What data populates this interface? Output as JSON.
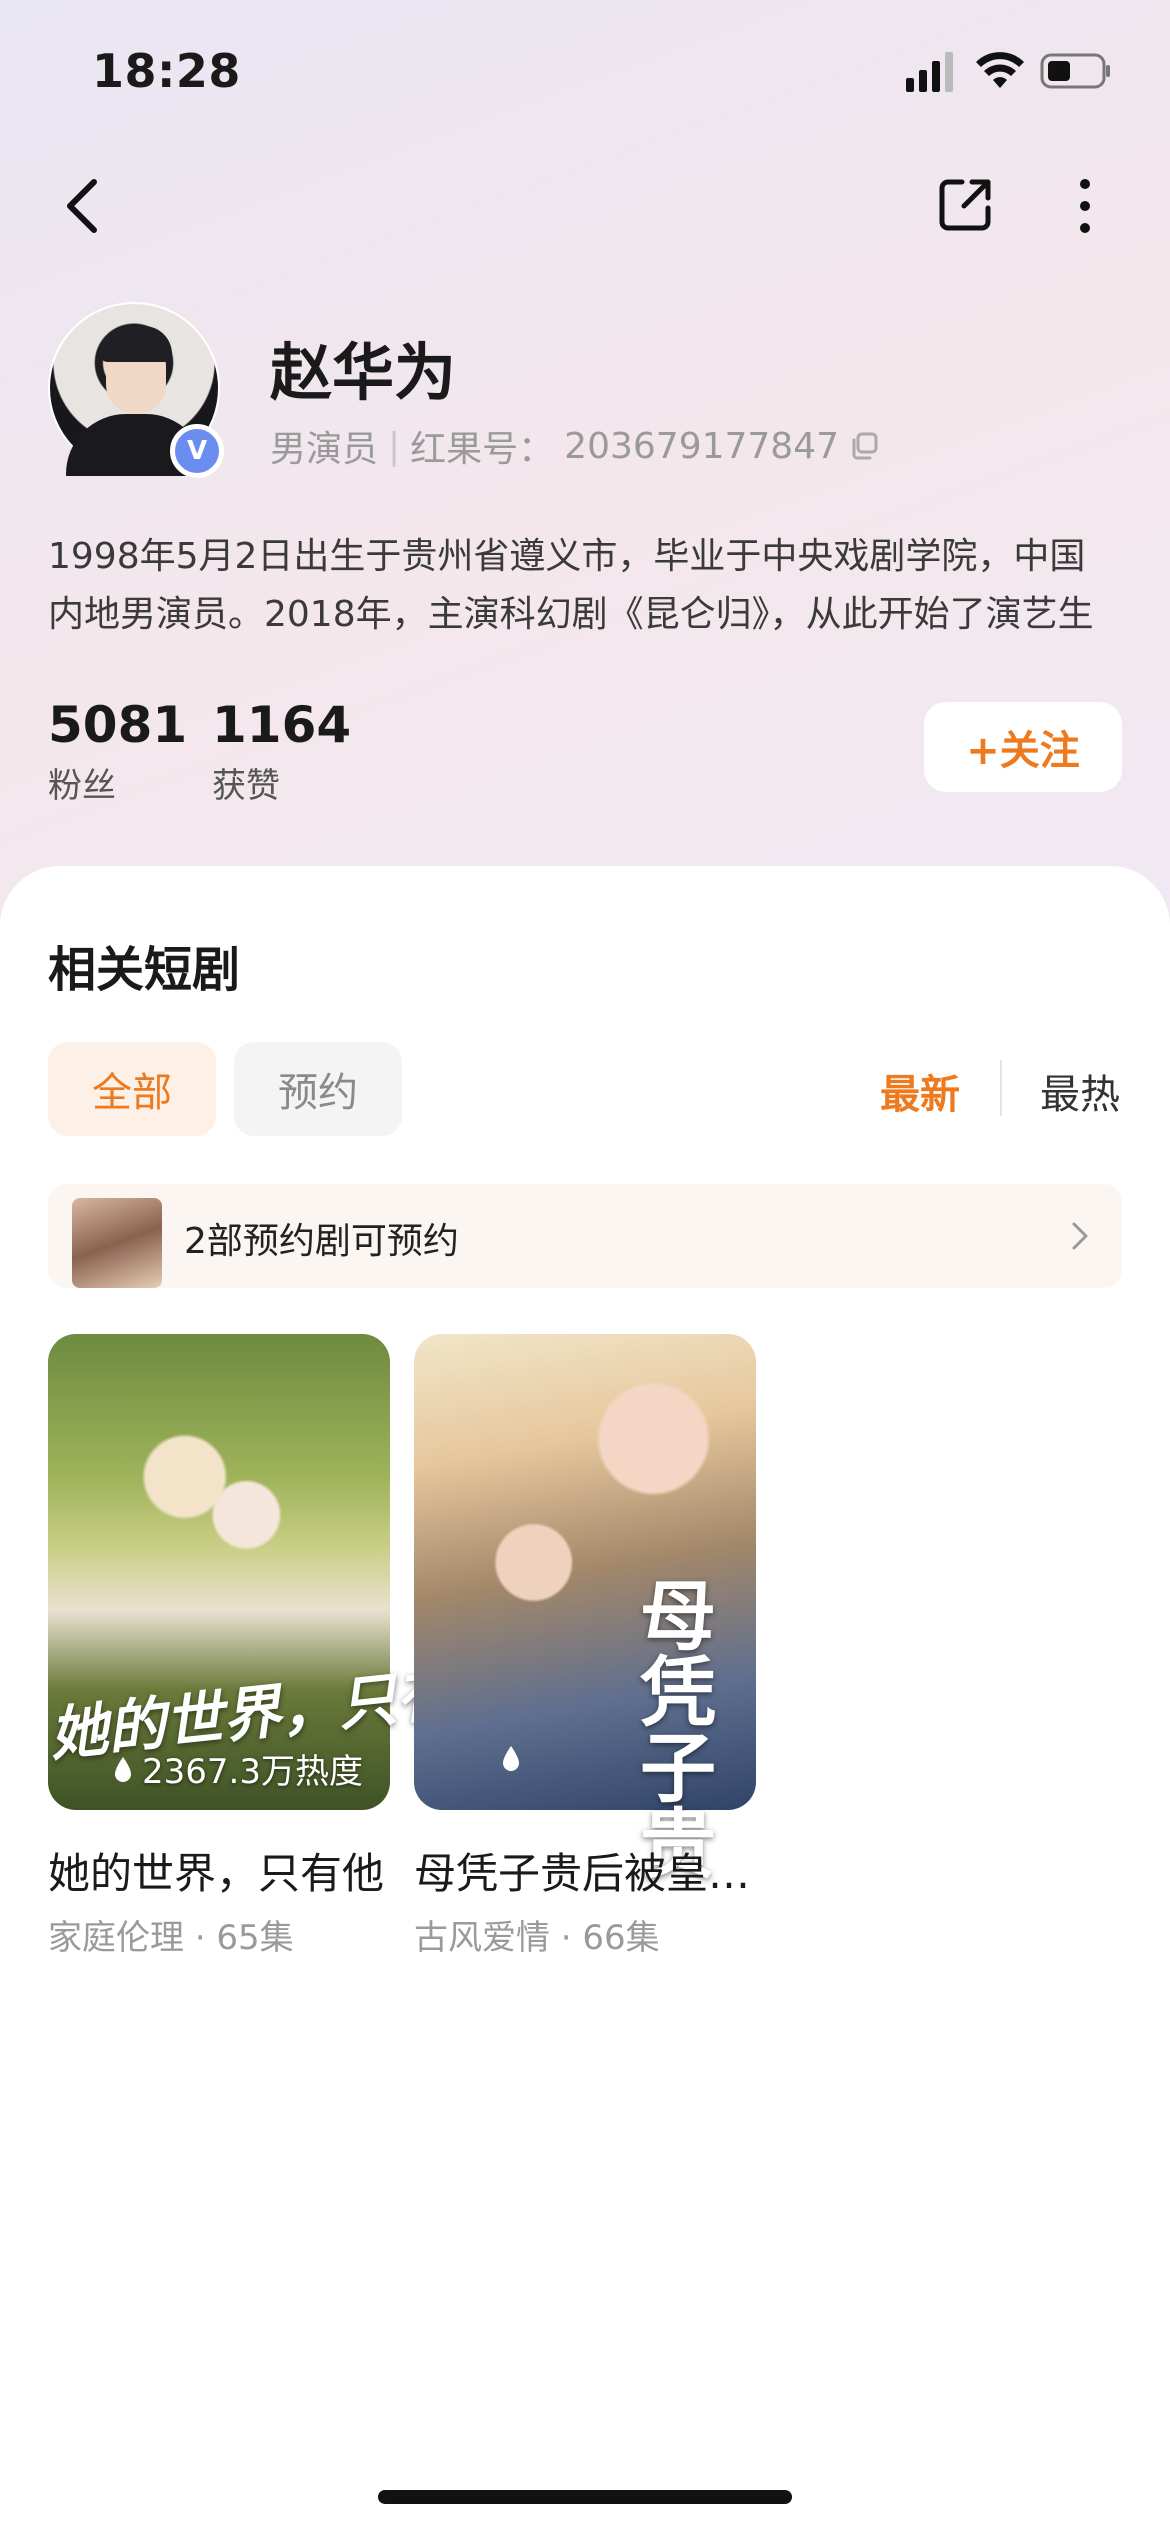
{
  "status_bar": {
    "time": "18:28"
  },
  "profile": {
    "name": "赵华为",
    "role": "男演员",
    "id_label": "红果号：",
    "id_value": "203679177847",
    "verified_badge": "V",
    "bio": "1998年5月2日出生于贵州省遵义市，毕业于中央戏剧学院，中国内地男演员。2018年，主演科幻剧《昆仑归》，从此开始了演艺生涯",
    "fans_count": "5081",
    "fans_label": "粉丝",
    "likes_count": "1164",
    "likes_label": "获赞",
    "follow_label": "+关注"
  },
  "section": {
    "title": "相关短剧",
    "tabs": [
      {
        "label": "全部",
        "active": true
      },
      {
        "label": "预约",
        "active": false
      }
    ],
    "sort": {
      "newest": "最新",
      "hottest": "最热",
      "active": "newest"
    },
    "reserve_text": "2部预约剧可预约"
  },
  "dramas": [
    {
      "title": "她的世界，只有他",
      "poster_text": "她的世界，只有他",
      "heat": "2367.3万热度",
      "meta": "家庭伦理 · 65集"
    },
    {
      "title": "母凭子贵后被皇家宠上天",
      "poster_text": "母凭子贵",
      "heat": "",
      "meta": "古风爱情 · 66集"
    }
  ],
  "colors": {
    "accent": "#ee7a1f",
    "verified": "#6c8df0"
  },
  "icons": [
    "back-icon",
    "share-icon",
    "more-icon",
    "copy-icon",
    "chevron-right-icon",
    "heat-drop-icon",
    "signal-icon",
    "wifi-icon",
    "battery-icon"
  ]
}
